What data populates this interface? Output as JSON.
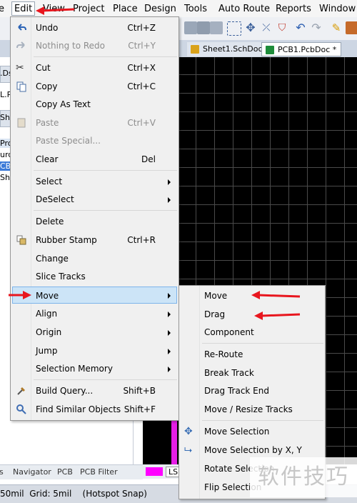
{
  "menubar": {
    "items": [
      "e",
      "Edit",
      "View",
      "Project",
      "Place",
      "Design",
      "Tools",
      "Auto Route",
      "Reports",
      "Window"
    ]
  },
  "doc_tabs": [
    "Sheet1.SchDoc",
    "PCB1.PcbDoc *"
  ],
  "left_panel": {
    "fragments": [
      ".Ds",
      "L.Pr",
      "Sh",
      "Pro",
      "urce",
      "CB",
      "She"
    ],
    "bottom_tabs": [
      "s",
      "Navigator",
      "PCB",
      "PCB Filter"
    ]
  },
  "layer_label": "LS",
  "status_bar": "50mil  Grid: 5mil    (Hotspot Snap)",
  "edit_menu": {
    "items": [
      {
        "label": "Undo",
        "shortcut": "Ctrl+Z",
        "icon": "undo-icon"
      },
      {
        "label": "Nothing to Redo",
        "shortcut": "Ctrl+Y",
        "icon": "redo-icon",
        "disabled": true
      },
      {
        "label": "Cut",
        "shortcut": "Ctrl+X",
        "icon": "scissors-icon"
      },
      {
        "label": "Copy",
        "shortcut": "Ctrl+C",
        "icon": "copy-icon"
      },
      {
        "label": "Copy As Text",
        "shortcut": ""
      },
      {
        "label": "Paste",
        "shortcut": "Ctrl+V",
        "icon": "paste-icon",
        "disabled": true
      },
      {
        "label": "Paste Special...",
        "shortcut": "",
        "disabled": true
      },
      {
        "label": "Clear",
        "shortcut": "Del"
      },
      {
        "label": "Select",
        "submenu": true
      },
      {
        "label": "DeSelect",
        "submenu": true
      },
      {
        "label": "Delete",
        "shortcut": ""
      },
      {
        "label": "Rubber Stamp",
        "shortcut": "Ctrl+R",
        "icon": "stamp-icon"
      },
      {
        "label": "Change",
        "shortcut": ""
      },
      {
        "label": "Slice Tracks",
        "shortcut": ""
      },
      {
        "label": "Move",
        "submenu": true,
        "highlighted": true
      },
      {
        "label": "Align",
        "submenu": true
      },
      {
        "label": "Origin",
        "submenu": true
      },
      {
        "label": "Jump",
        "submenu": true
      },
      {
        "label": "Selection Memory",
        "submenu": true
      },
      {
        "label": "Build Query...",
        "shortcut": "Shift+B",
        "icon": "build-query-icon"
      },
      {
        "label": "Find Similar Objects",
        "shortcut": "Shift+F",
        "icon": "find-icon"
      }
    ]
  },
  "move_submenu": {
    "items": [
      "Move",
      "Drag",
      "Component",
      "Re-Route",
      "Break Track",
      "Drag Track End",
      "Move / Resize Tracks",
      "Move Selection",
      "Move Selection by X, Y",
      "Rotate Selection",
      "Flip Selection"
    ]
  },
  "watermark": "软件技巧",
  "colors": {
    "arrow": "#e8161e",
    "highlight": "#cce4f7",
    "pcb_bg": "#000000",
    "grid": "#4a4a4a"
  }
}
